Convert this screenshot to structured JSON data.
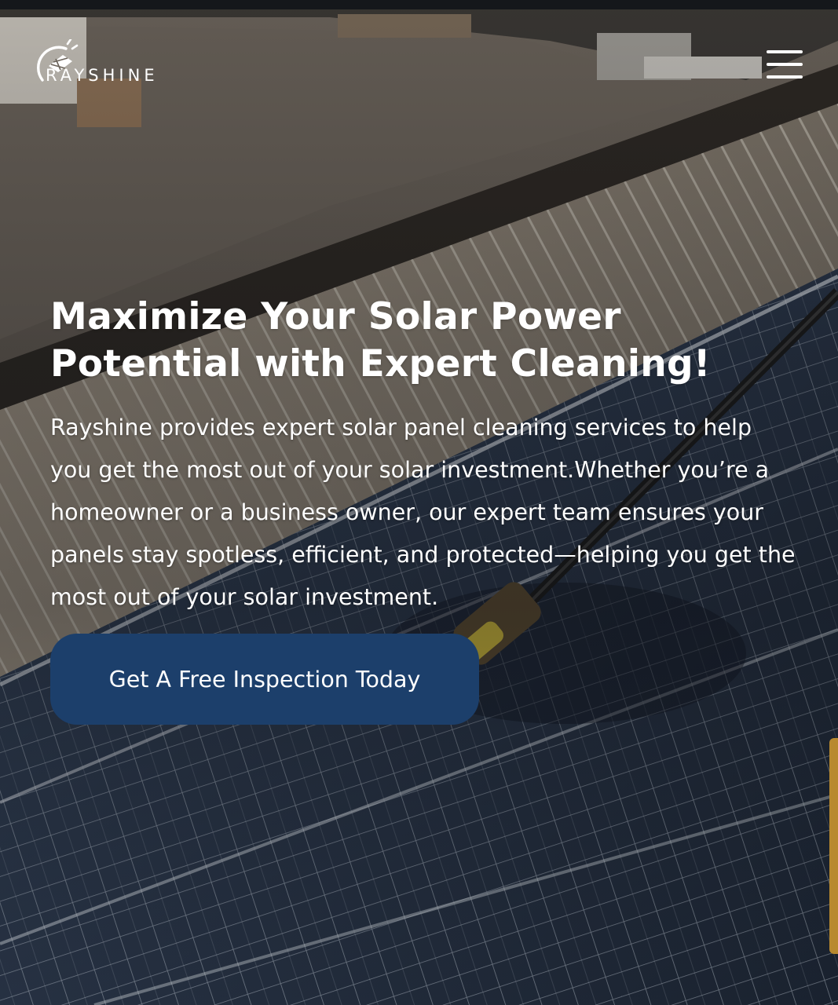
{
  "brand": {
    "name": "RAYSHINE",
    "logo_icon": "solar-sun-logo-icon"
  },
  "header": {
    "menu_icon": "hamburger-menu-icon"
  },
  "hero": {
    "title": "Maximize Your Solar Power Potential with Expert Cleaning!",
    "description": "Rayshine provides expert solar panel cleaning services to help you get the most out of your solar investment.Whether you’re a homeowner or a business owner, our expert team ensures your panels stay spotless, efficient, and protected—helping you get the most out of your solar investment.",
    "cta_label": "Get A Free Inspection Today"
  },
  "colors": {
    "cta_background": "#1c3f6b",
    "text": "#ffffff",
    "scroll_handle": "#b8892e"
  }
}
